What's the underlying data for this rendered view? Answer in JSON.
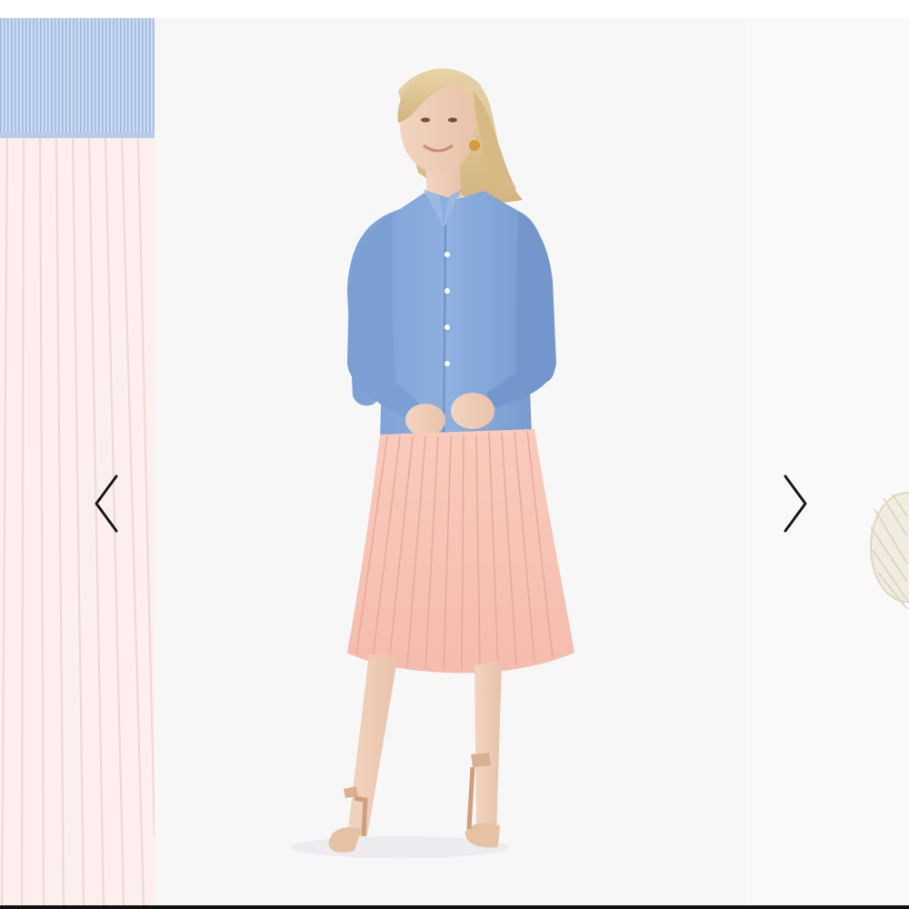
{
  "carousel": {
    "previous_slide": {
      "icon": "pleated-skirt-photo",
      "shirt_color": "#a9c3e6",
      "skirt_color": "#fbeaea"
    },
    "current_slide": {
      "icon": "model-in-shirt-dress-photo",
      "shirt_color": "#7fa3d6",
      "skirt_color": "#f7c4b6",
      "background": "#f7f7f8"
    },
    "next_slide": {
      "icon": "woven-item-photo"
    },
    "prev_button": {
      "icon": "chevron-left-icon",
      "color": "#1a1a1a"
    },
    "next_button": {
      "icon": "chevron-right-icon",
      "color": "#1a1a1a"
    }
  }
}
